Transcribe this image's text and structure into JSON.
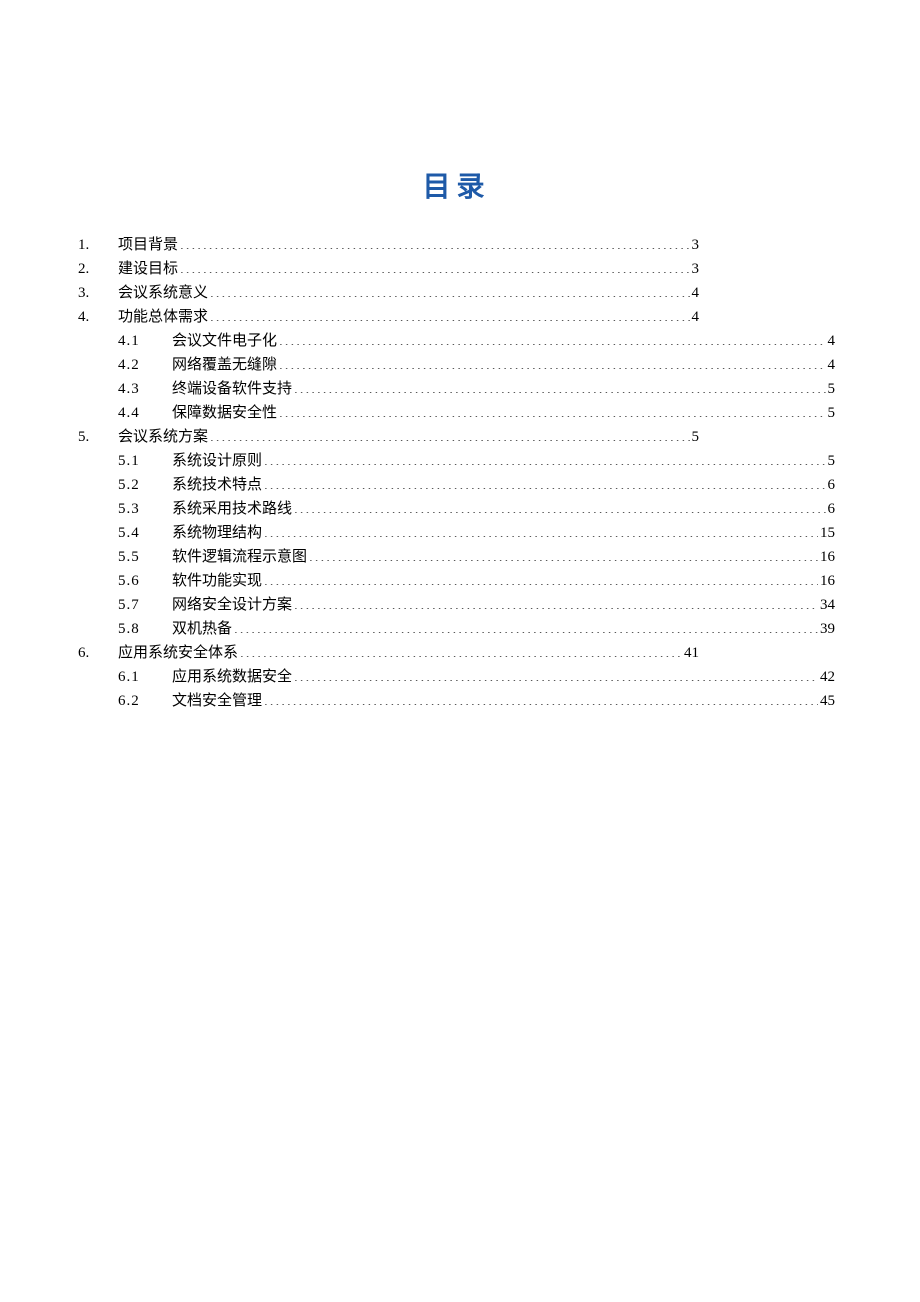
{
  "title": "目录",
  "entries": [
    {
      "level": 1,
      "num": "1.",
      "label": "项目背景",
      "page": "3"
    },
    {
      "level": 1,
      "num": "2.",
      "label": "建设目标",
      "page": "3"
    },
    {
      "level": 1,
      "num": "3.",
      "label": "会议系统意义",
      "page": "4"
    },
    {
      "level": 1,
      "num": "4.",
      "label": "功能总体需求",
      "page": "4"
    },
    {
      "level": 2,
      "num": "4.1",
      "label": "会议文件电子化",
      "page": "4"
    },
    {
      "level": 2,
      "num": "4.2",
      "label": "网络覆盖无缝隙",
      "page": "4"
    },
    {
      "level": 2,
      "num": "4.3",
      "label": "终端设备软件支持",
      "page": "5"
    },
    {
      "level": 2,
      "num": "4.4",
      "label": "保障数据安全性",
      "page": "5"
    },
    {
      "level": 1,
      "num": "5.",
      "label": "会议系统方案",
      "page": "5"
    },
    {
      "level": 2,
      "num": "5.1",
      "label": "系统设计原则",
      "page": "5"
    },
    {
      "level": 2,
      "num": "5.2",
      "label": "系统技术特点",
      "page": "6"
    },
    {
      "level": 2,
      "num": "5.3",
      "label": "系统采用技术路线",
      "page": "6"
    },
    {
      "level": 2,
      "num": "5.4",
      "label": "系统物理结构",
      "page": "15"
    },
    {
      "level": 2,
      "num": "5.5",
      "label": "软件逻辑流程示意图",
      "page": "16"
    },
    {
      "level": 2,
      "num": "5.6",
      "label": "软件功能实现",
      "page": "16"
    },
    {
      "level": 2,
      "num": "5.7",
      "label": "网络安全设计方案",
      "page": "34"
    },
    {
      "level": 2,
      "num": "5.8",
      "label": "双机热备",
      "page": "39"
    },
    {
      "level": 1,
      "num": "6.",
      "label": "应用系统安全体系",
      "page": "41"
    },
    {
      "level": 2,
      "num": "6.1",
      "label": "应用系统数据安全",
      "page": "42"
    },
    {
      "level": 2,
      "num": "6.2",
      "label": "文档安全管理",
      "page": "45"
    }
  ]
}
